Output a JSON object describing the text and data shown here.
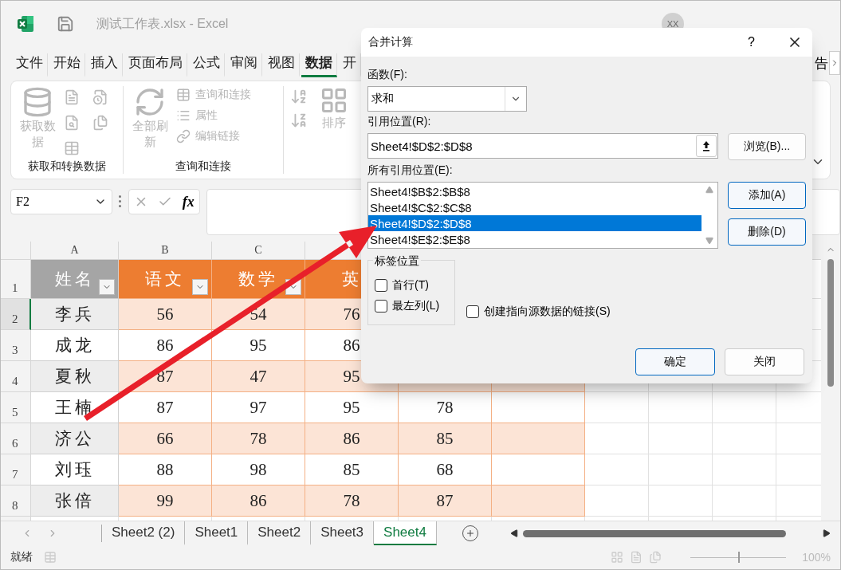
{
  "window": {
    "title": "测试工作表.xlsx  -  Excel",
    "avatar": "XX"
  },
  "menu_tabs": [
    {
      "label": "文件",
      "selected": false
    },
    {
      "label": "开始",
      "selected": false
    },
    {
      "label": "插入",
      "selected": false
    },
    {
      "label": "页面布局",
      "selected": false
    },
    {
      "label": "公式",
      "selected": false
    },
    {
      "label": "审阅",
      "selected": false
    },
    {
      "label": "视图",
      "selected": false
    },
    {
      "label": "数据",
      "selected": true
    },
    {
      "label": "开",
      "selected": false
    }
  ],
  "menu_right": "告",
  "ribbon": {
    "groups": [
      {
        "label": "获取和转换数据",
        "large": {
          "kind": "database",
          "label": "获取数据",
          "disabled": true
        }
      },
      {
        "label": "查询和连接",
        "large": {
          "kind": "refresh",
          "label": "全部刷新",
          "disabled": true
        },
        "small": [
          {
            "kind": "table",
            "label": "查询和连接",
            "disabled": true
          },
          {
            "kind": "list",
            "label": "属性",
            "disabled": true
          },
          {
            "kind": "link",
            "label": "编辑链接",
            "disabled": true
          }
        ]
      },
      {
        "large": {
          "kind": "sort",
          "label": "排序",
          "disabled": true
        }
      }
    ]
  },
  "formula_bar": {
    "name_box": "F2",
    "function_symbol": "fx"
  },
  "sheet": {
    "columns": [
      "A",
      "B",
      "C"
    ],
    "rows": [
      {
        "header": "1",
        "selected": false,
        "cells": [
          "姓名",
          "语文",
          "数学",
          "英"
        ]
      },
      {
        "header": "2",
        "selected": true,
        "cells": [
          "李兵",
          "56",
          "54",
          "76"
        ]
      },
      {
        "header": "3",
        "selected": false,
        "cells": [
          "成龙",
          "86",
          "95",
          "86"
        ]
      },
      {
        "header": "4",
        "selected": false,
        "cells": [
          "夏秋",
          "87",
          "47",
          "95"
        ]
      },
      {
        "header": "5",
        "selected": false,
        "cells": [
          "王楠",
          "87",
          "97",
          "95",
          "78"
        ]
      },
      {
        "header": "6",
        "selected": false,
        "cells": [
          "济公",
          "66",
          "78",
          "86",
          "85"
        ]
      },
      {
        "header": "7",
        "selected": false,
        "cells": [
          "刘珏",
          "88",
          "98",
          "85",
          "68"
        ]
      },
      {
        "header": "8",
        "selected": false,
        "cells": [
          "张倍",
          "99",
          "86",
          "78",
          "87"
        ]
      }
    ]
  },
  "sheet_tabs": [
    {
      "label": "Sheet2 (2)",
      "selected": false
    },
    {
      "label": "Sheet1",
      "selected": false
    },
    {
      "label": "Sheet2",
      "selected": false
    },
    {
      "label": "Sheet3",
      "selected": false
    },
    {
      "label": "Sheet4",
      "selected": true
    }
  ],
  "status_bar": {
    "status": "就绪",
    "zoom": "100%",
    "zoom_slider": {
      "level": 0.5
    }
  },
  "dialog": {
    "title": "合并计算",
    "help": "?",
    "function_label": "函数(F):",
    "function_value": "求和",
    "reference_label": "引用位置(R):",
    "reference_value": "Sheet4!$D$2:$D$8",
    "browse": "浏览(B)...",
    "all_references_label": "所有引用位置(E):",
    "all_references": [
      {
        "text": "Sheet4!$B$2:$B$8",
        "selected": false
      },
      {
        "text": "Sheet4!$C$2:$C$8",
        "selected": false
      },
      {
        "text": "Sheet4!$D$2:$D$8",
        "selected": true
      },
      {
        "text": "Sheet4!$E$2:$E$8",
        "selected": false
      }
    ],
    "add": "添加(A)",
    "delete": "删除(D)",
    "label_group": "标签位置",
    "checkboxes": [
      {
        "label": "首行(T)",
        "checked": false
      },
      {
        "label": "最左列(L)",
        "checked": false
      },
      {
        "label": "创建指向源数据的链接(S)",
        "checked": false
      }
    ],
    "ok": "确定",
    "close": "关闭"
  }
}
